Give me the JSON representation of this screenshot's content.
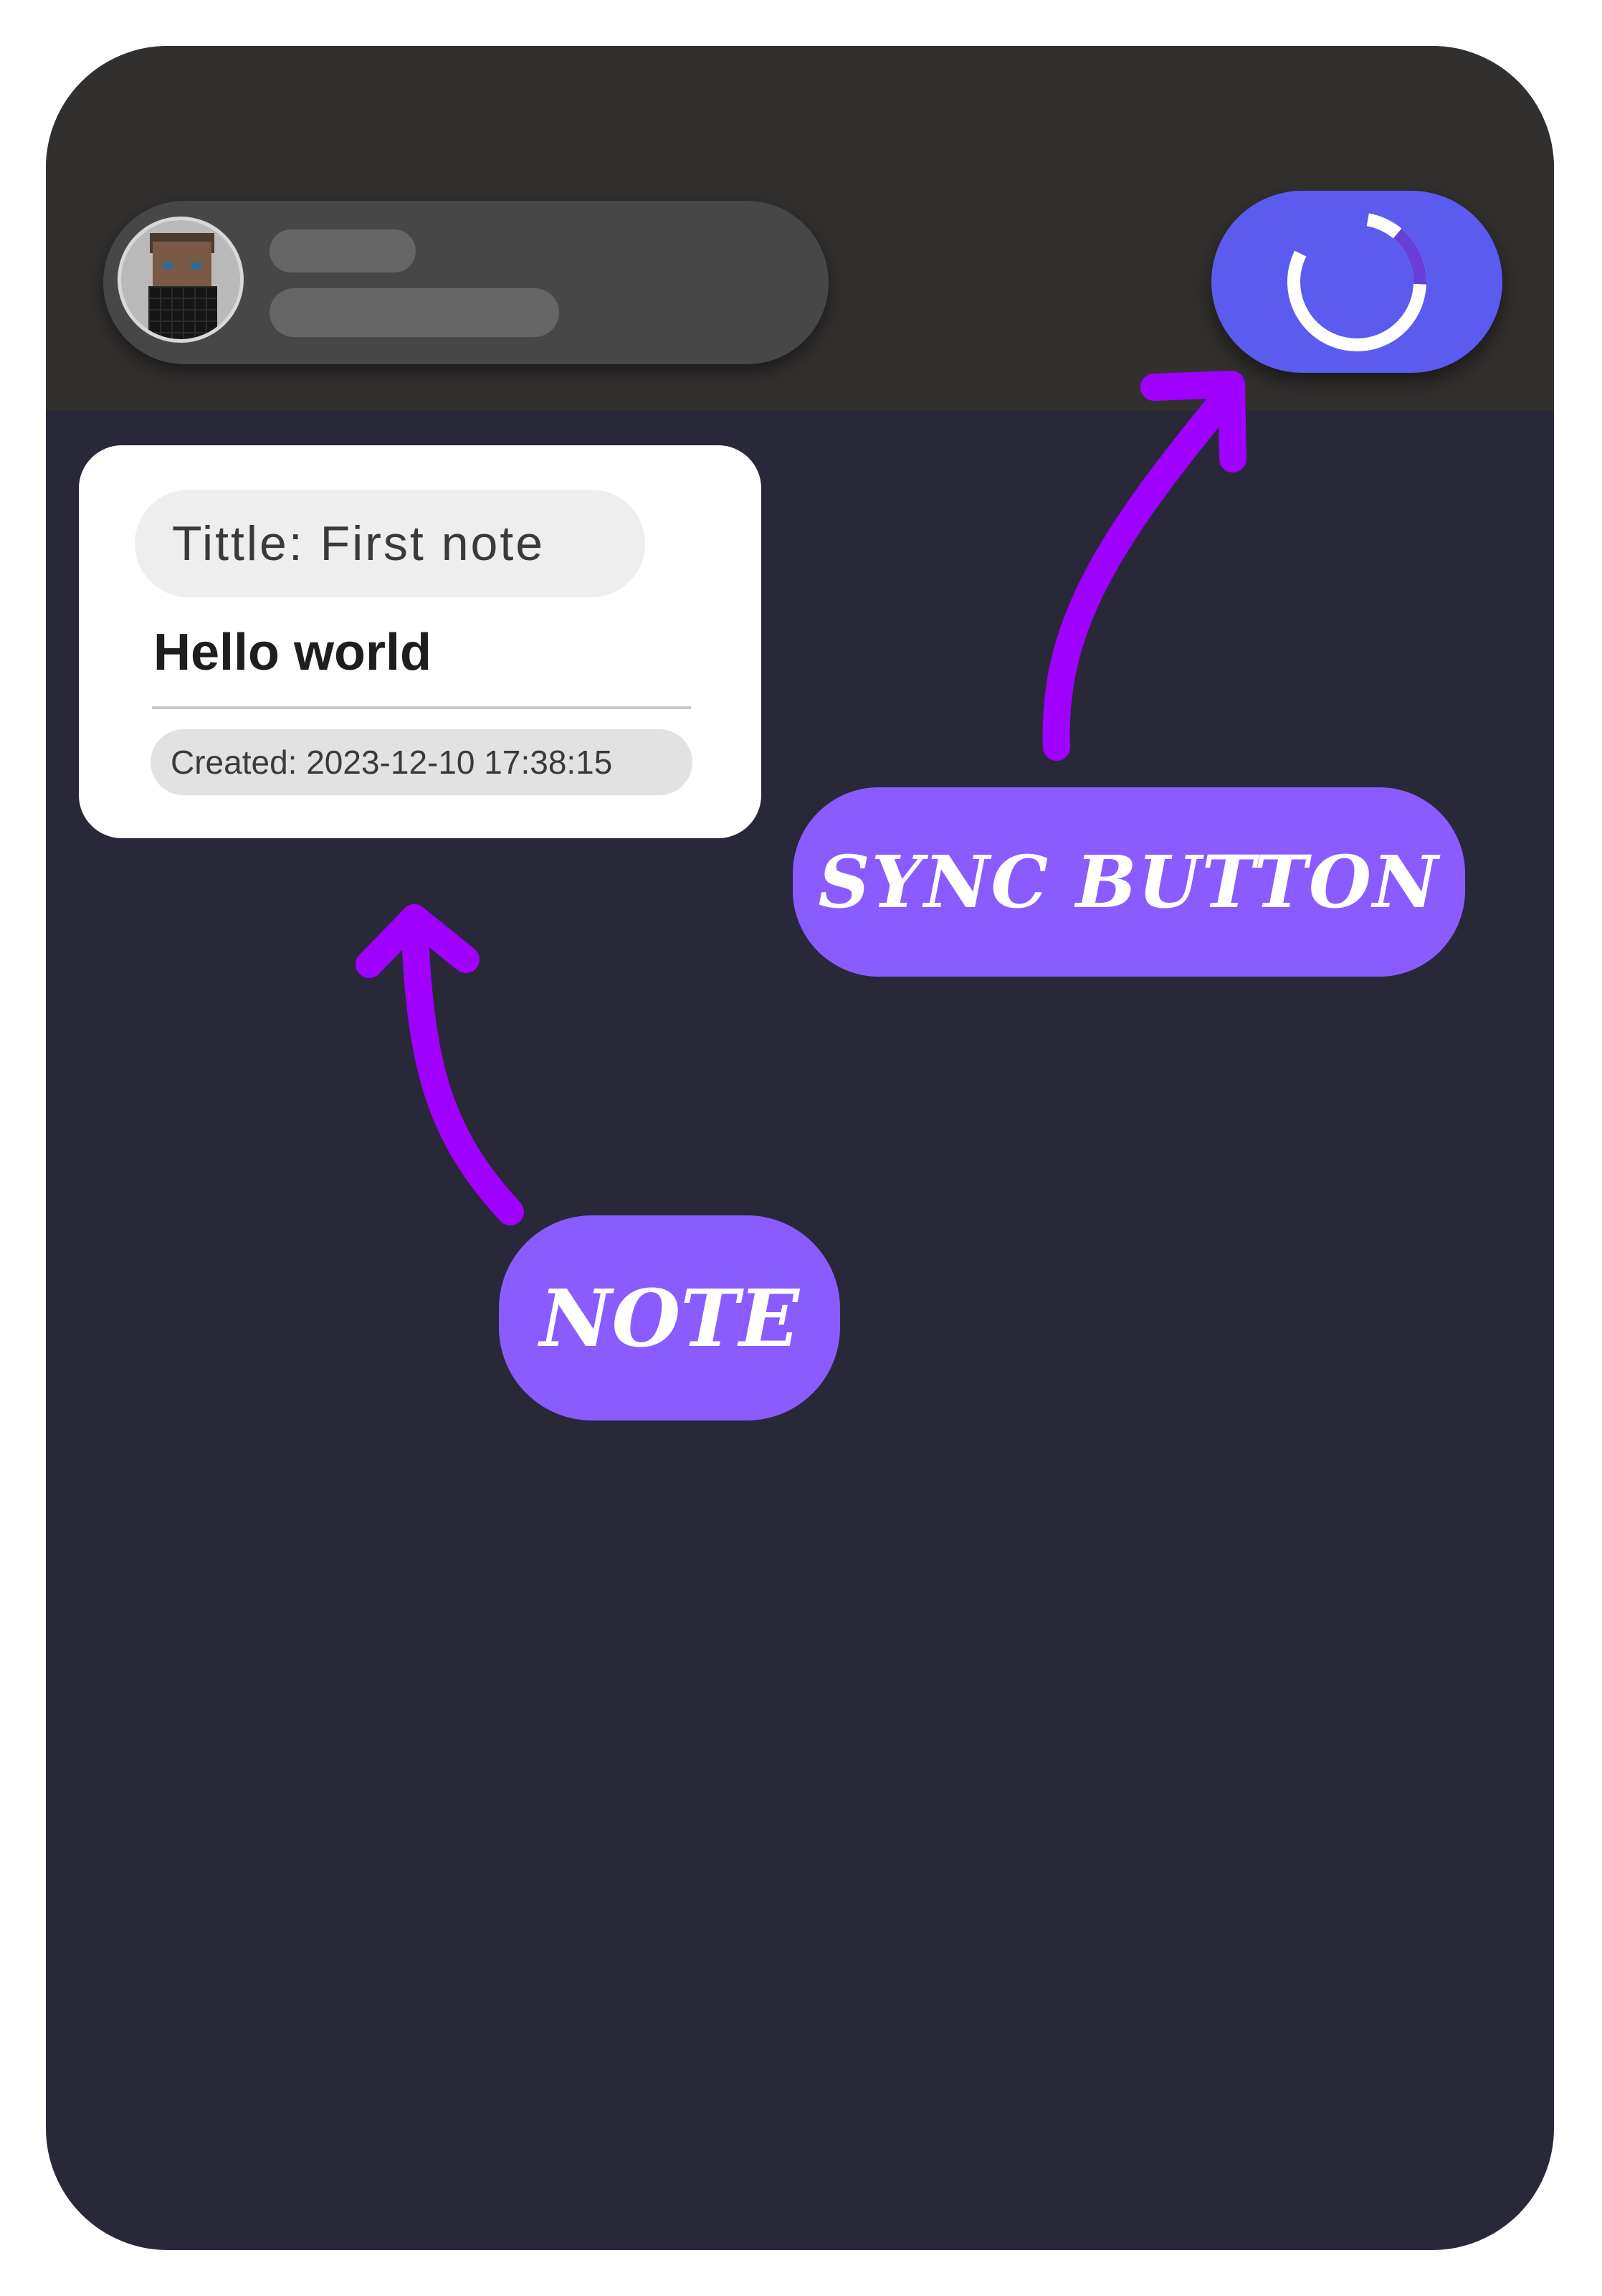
{
  "header": {
    "avatar_icon": "pixel-avatar-icon",
    "sync_button_icon": "loading-spinner-icon"
  },
  "note": {
    "title": "Tittle: First note",
    "body": "Hello world",
    "created": "Created: 2023-12-10 17:38:15"
  },
  "annotations": {
    "sync_label": "Sync Button",
    "note_label": "Note"
  },
  "colors": {
    "page_background": "#292839",
    "topbar": "#32302f",
    "sync_button": "#5b5bef",
    "callout": "#8a5cff",
    "arrow": "#9f00ff",
    "card": "#ffffff"
  }
}
